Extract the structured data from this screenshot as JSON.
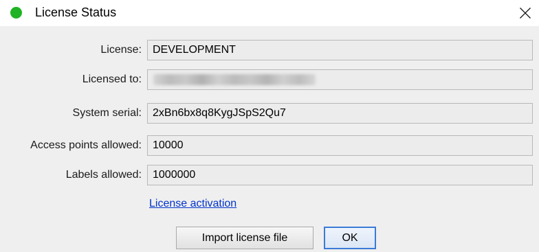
{
  "window": {
    "title": "License Status",
    "status_color": "#1fb325",
    "status_icon": "green-status-dot-icon",
    "close_icon": "close-icon"
  },
  "fields": [
    {
      "label": "License:",
      "value": "DEVELOPMENT"
    },
    {
      "label": "Licensed to:",
      "value": ""
    },
    {
      "label": "System serial:",
      "value": "2xBn6bx8q8KygJSpS2Qu7"
    },
    {
      "label": "Access points allowed:",
      "value": "10000"
    },
    {
      "label": "Labels allowed:",
      "value": "1000000"
    }
  ],
  "link": {
    "label": "License activation"
  },
  "buttons": {
    "import_label": "Import license file",
    "ok_label": "OK"
  }
}
